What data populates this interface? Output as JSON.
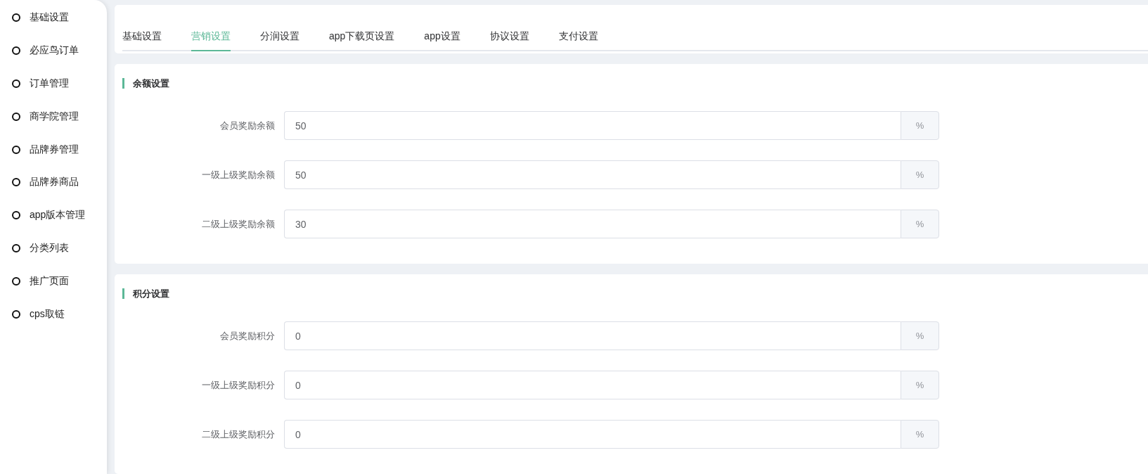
{
  "sidebar": {
    "items": [
      {
        "label": "基础设置"
      },
      {
        "label": "必应鸟订单"
      },
      {
        "label": "订单管理"
      },
      {
        "label": "商学院管理"
      },
      {
        "label": "品牌券管理"
      },
      {
        "label": "品牌券商品"
      },
      {
        "label": "app版本管理"
      },
      {
        "label": "分类列表"
      },
      {
        "label": "推广页面"
      },
      {
        "label": "cps取链"
      }
    ]
  },
  "tabs": [
    {
      "label": "基础设置",
      "selected": false
    },
    {
      "label": "营销设置",
      "selected": true
    },
    {
      "label": "分润设置",
      "selected": false
    },
    {
      "label": "app下载页设置",
      "selected": false
    },
    {
      "label": "app设置",
      "selected": false
    },
    {
      "label": "协议设置",
      "selected": false
    },
    {
      "label": "支付设置",
      "selected": false
    }
  ],
  "sections": [
    {
      "title": "余额设置",
      "fields": [
        {
          "label": "会员奖励余额",
          "value": "50",
          "suffix": "%"
        },
        {
          "label": "一级上级奖励余额",
          "value": "50",
          "suffix": "%"
        },
        {
          "label": "二级上级奖励余额",
          "value": "30",
          "suffix": "%"
        }
      ]
    },
    {
      "title": "积分设置",
      "fields": [
        {
          "label": "会员奖励积分",
          "value": "0",
          "suffix": "%"
        },
        {
          "label": "一级上级奖励积分",
          "value": "0",
          "suffix": "%"
        },
        {
          "label": "二级上级奖励积分",
          "value": "0",
          "suffix": "%"
        }
      ]
    }
  ]
}
